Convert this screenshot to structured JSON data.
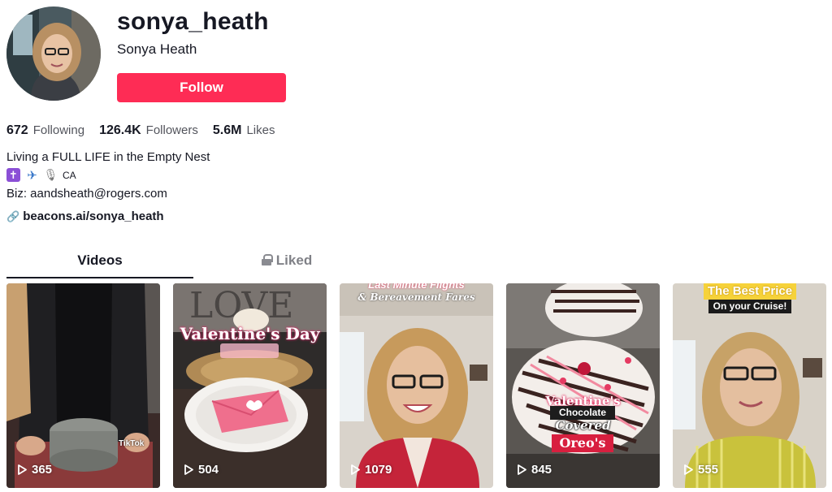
{
  "profile": {
    "username": "sonya_heath",
    "display_name": "Sonya Heath",
    "follow_label": "Follow",
    "stats": [
      {
        "value": "672",
        "label": "Following"
      },
      {
        "value": "126.4K",
        "label": "Followers"
      },
      {
        "value": "5.6M",
        "label": "Likes"
      }
    ],
    "bio": "Living a FULL LIFE in the Empty Nest",
    "bio_emoji_icons": [
      "latin-cross-icon",
      "airplane-icon",
      "microphone-icon"
    ],
    "bio_country": "CA",
    "biz": "Biz: aandsheath@rogers.com",
    "link": "beacons.ai/sonya_heath"
  },
  "tabs": {
    "videos": "Videos",
    "liked": "Liked"
  },
  "videos": [
    {
      "views": "365",
      "watermark": "TikTok"
    },
    {
      "views": "504",
      "overlay_title": "Valentine's Day"
    },
    {
      "views": "1079",
      "overlay_line1": "Last Minute Flights",
      "overlay_line2": "& Bereavement Fares"
    },
    {
      "views": "845",
      "overlay_line1": "Valentine's",
      "overlay_line2": "Chocolate",
      "overlay_line3": "Covered",
      "overlay_line4": "Oreo's"
    },
    {
      "views": "555",
      "overlay_line1": "The Best Price",
      "overlay_line2": "On your Cruise!"
    }
  ],
  "colors": {
    "follow_button": "#fe2c55",
    "text_primary": "#161823"
  }
}
